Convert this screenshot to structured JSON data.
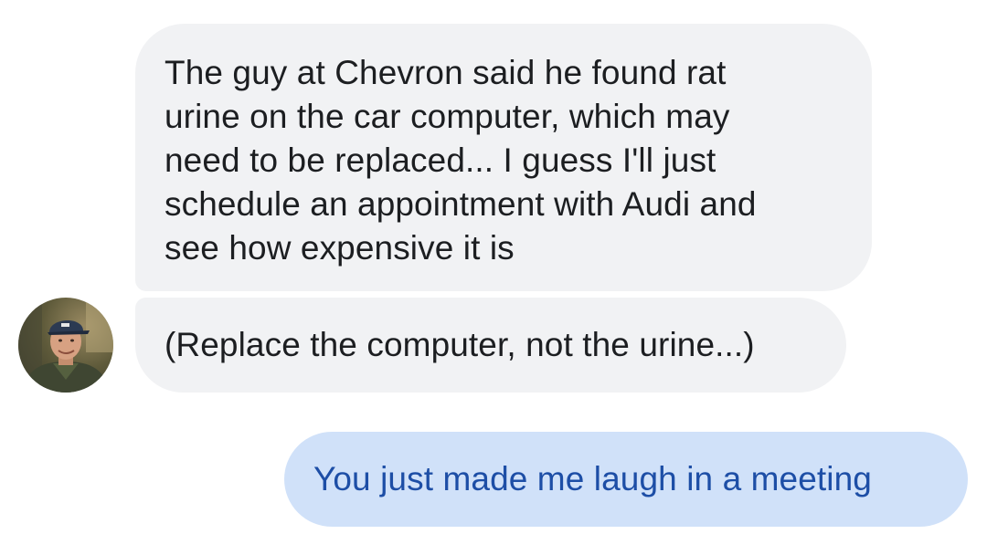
{
  "messages": [
    {
      "sender": "other",
      "lines": [
        "The guy at Chevron said he found rat",
        "urine on the car computer, which may",
        "need to be replaced... I guess I'll just",
        "schedule an appointment with Audi and",
        "see how expensive it is"
      ]
    },
    {
      "sender": "other",
      "text": "(Replace the computer, not the urine...)"
    },
    {
      "sender": "me",
      "text": "You just made me laugh in a meeting"
    }
  ],
  "avatar": {
    "icon": "profile-photo-icon"
  },
  "colors": {
    "incoming_bubble": "#f1f2f4",
    "incoming_text": "#1c1e21",
    "outgoing_bubble": "#d0e1f9",
    "outgoing_text": "#1d4ea6"
  }
}
